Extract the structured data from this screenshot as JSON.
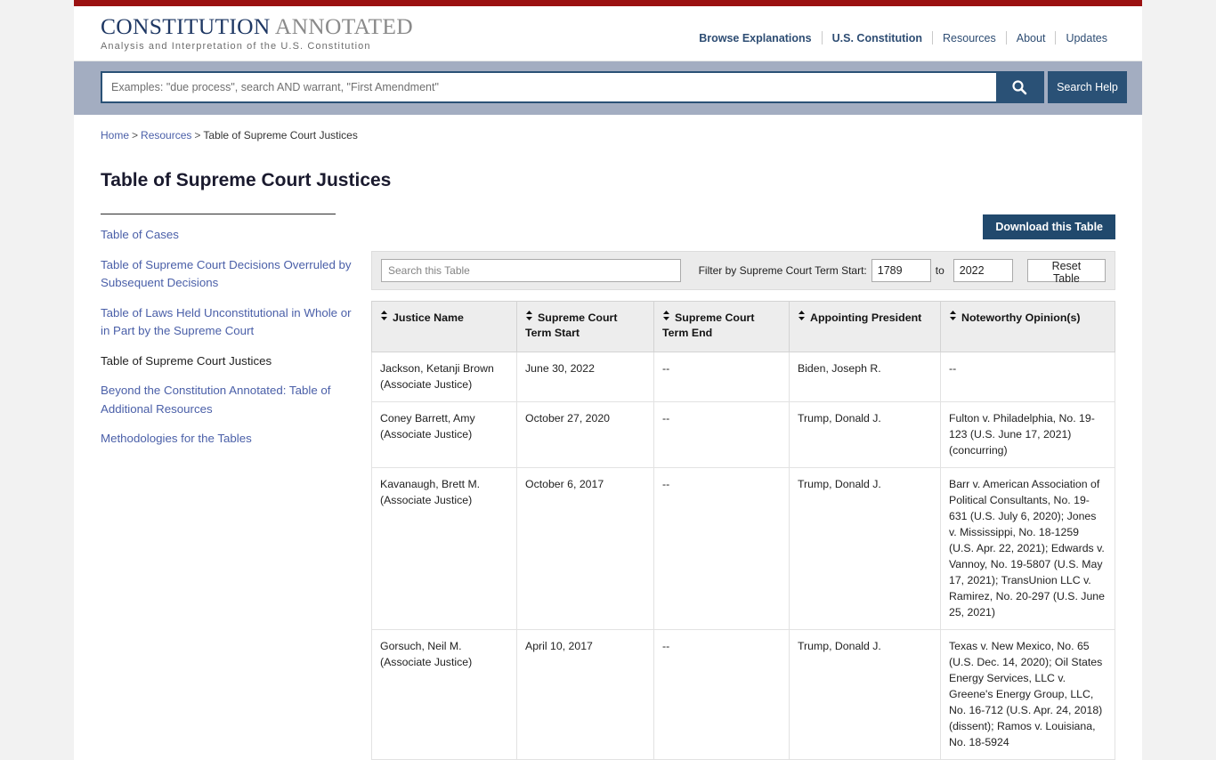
{
  "header": {
    "brand_line1_part1": "CONSTITUTION",
    "brand_line1_part2": " ANNOTATED",
    "brand_line2": "Analysis and Interpretation of the U.S. Constitution",
    "nav": [
      {
        "label": "Browse Explanations",
        "bold": true
      },
      {
        "label": "U.S. Constitution",
        "bold": true
      },
      {
        "label": "Resources",
        "bold": false
      },
      {
        "label": "About",
        "bold": false
      },
      {
        "label": "Updates",
        "bold": false
      }
    ],
    "accent_red": "#9b1111",
    "brand_blue": "#1f3864"
  },
  "search": {
    "placeholder": "Examples: \"due process\", search AND warrant, \"First Amendment\"",
    "value": "",
    "search_icon": "search-icon",
    "help_label": "Search Help",
    "band_color": "#a3adc1",
    "button_color": "#2a5176"
  },
  "breadcrumb": {
    "home": "Home",
    "resources": "Resources",
    "current": "Table of Supreme Court Justices",
    "separator": ">"
  },
  "page": {
    "title": "Table of Supreme Court Justices"
  },
  "sidebar": {
    "items": [
      {
        "label": "Table of Cases",
        "current": false
      },
      {
        "label": "Table of Supreme Court Decisions Overruled by Subsequent Decisions",
        "current": false
      },
      {
        "label": "Table of Laws Held Unconstitutional in Whole or in Part by the Supreme Court",
        "current": false
      },
      {
        "label": "Table of Supreme Court Justices",
        "current": true
      },
      {
        "label": "Beyond the Constitution Annotated: Table of Additional Resources",
        "current": false
      },
      {
        "label": "Methodologies for the Tables",
        "current": false
      }
    ]
  },
  "toolbar": {
    "download_label": "Download this Table",
    "search_placeholder": "Search this Table",
    "search_value": "",
    "filter_label": "Filter by Supreme Court Term Start:",
    "term_start": "1789",
    "to_label": "to",
    "term_end": "2022",
    "reset_label": "Reset Table"
  },
  "table": {
    "columns": [
      "Justice Name",
      "Supreme Court Term Start",
      "Supreme Court Term End",
      "Appointing President",
      "Noteworthy Opinion(s)"
    ],
    "rows": [
      {
        "name": "Jackson, Ketanji Brown (Associate Justice)",
        "term_start": "June 30, 2022",
        "term_end": "--",
        "president": "Biden, Joseph R.",
        "opinions": "--"
      },
      {
        "name": "Coney Barrett, Amy (Associate Justice)",
        "term_start": "October 27, 2020",
        "term_end": "--",
        "president": "Trump, Donald J.",
        "opinions": "Fulton v. Philadelphia, No. 19-123 (U.S. June 17, 2021) (concurring)"
      },
      {
        "name": "Kavanaugh, Brett M. (Associate Justice)",
        "term_start": "October 6, 2017",
        "term_end": "--",
        "president": "Trump, Donald J.",
        "opinions": "Barr v. American Association of Political Consultants, No. 19-631 (U.S. July 6, 2020);\nJones v. Mississippi, No. 18-1259 (U.S. Apr. 22, 2021);\nEdwards v. Vannoy, No. 19-5807 (U.S. May 17, 2021);\nTransUnion LLC v. Ramirez, No. 20-297 (U.S. June 25, 2021)"
      },
      {
        "name": "Gorsuch, Neil M. (Associate Justice)",
        "term_start": "April 10, 2017",
        "term_end": "--",
        "president": "Trump, Donald J.",
        "opinions": "Texas v. New Mexico, No. 65 (U.S. Dec. 14, 2020);\nOil States Energy Services, LLC v. Greene's Energy Group, LLC, No. 16-712 (U.S. Apr. 24, 2018) (dissent);\nRamos v. Louisiana, No. 18-5924"
      }
    ]
  }
}
